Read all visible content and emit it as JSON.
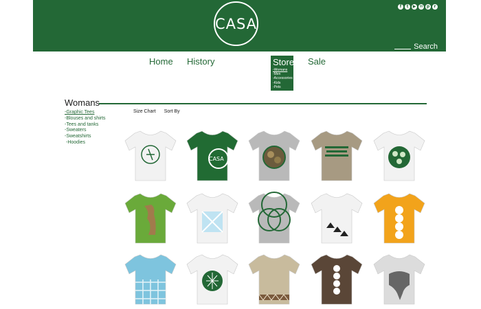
{
  "header": {
    "bg_color": "#236836",
    "logo_text": "CASA",
    "social_icons": [
      "facebook-icon",
      "twitter-icon",
      "youtube-icon",
      "email-icon",
      "pinterest-icon",
      "rss-icon"
    ],
    "search_label": "Search"
  },
  "nav": {
    "items": [
      "Home",
      "History",
      "Store",
      "Sale"
    ],
    "store_submenu": [
      "-Womans",
      "-Men",
      "-Accessories",
      "-Kids",
      "-Pets"
    ]
  },
  "section": {
    "title": "Womans",
    "categories": [
      "-Graphic Tees",
      "-Blouses and shirts",
      "-Tees and tanks",
      "-Sweaters",
      "-Sweatshirts",
      "-Hoodies"
    ],
    "active_category_index": 0,
    "toolbar": {
      "size_chart": "Size Chart",
      "sort_by": "Sort By"
    }
  },
  "products": [
    {
      "name": "white-tee-green-circle-emblem",
      "color": "#f2f2f2"
    },
    {
      "name": "green-tee-casa-logo",
      "color": "#216b33"
    },
    {
      "name": "grey-tee-photo-circle",
      "color": "#b9b9b9"
    },
    {
      "name": "khaki-tee-green-text",
      "color": "#a79a82"
    },
    {
      "name": "white-tee-green-pattern-circle",
      "color": "#f2f2f2"
    },
    {
      "name": "green-tee-tiger-print",
      "color": "#6aaa3a"
    },
    {
      "name": "white-tee-blue-squares",
      "color": "#f2f2f2"
    },
    {
      "name": "grey-tee-green-rings",
      "color": "#b9b9b9"
    },
    {
      "name": "white-tee-triangle-pattern",
      "color": "#f2f2f2"
    },
    {
      "name": "orange-tee-panda-stack",
      "color": "#f2a31b"
    },
    {
      "name": "blue-tee-tile-pattern",
      "color": "#7ec4de"
    },
    {
      "name": "white-tee-turtle-shell",
      "color": "#f2f2f2"
    },
    {
      "name": "beige-tee-aztec-band",
      "color": "#c8bb9d"
    },
    {
      "name": "brown-tee-owl-stack",
      "color": "#5a4637"
    },
    {
      "name": "white-tee-elephant",
      "color": "#dcdcdc"
    }
  ]
}
